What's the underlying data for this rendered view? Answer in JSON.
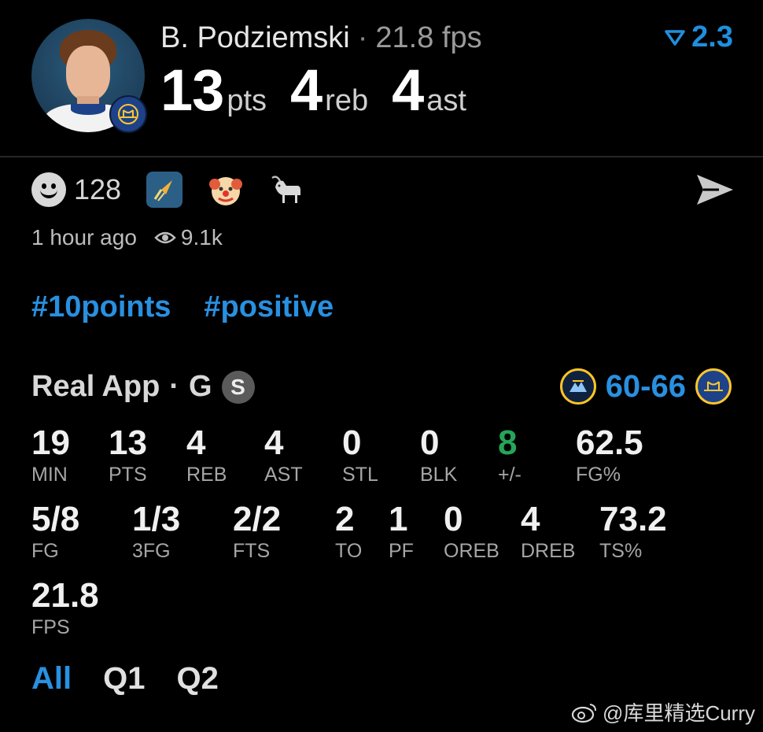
{
  "header": {
    "player_name": "B. Podziemski",
    "separator": "·",
    "fps_label": "21.8 fps",
    "pts_value": "13",
    "pts_unit": "pts",
    "reb_value": "4",
    "reb_unit": "reb",
    "ast_value": "4",
    "ast_unit": "ast",
    "rating": "2.3",
    "rating_icon": "down-chevron-icon",
    "accent_color": "#1f8fe0"
  },
  "reactions": {
    "smile_count": "128",
    "icons": [
      "rocket-icon",
      "clown-icon",
      "goat-icon"
    ],
    "send_icon": "send-icon"
  },
  "meta": {
    "time": "1 hour ago",
    "views": "9.1k"
  },
  "tags": [
    "#10points",
    "#positive"
  ],
  "game": {
    "app": "Real App",
    "dot": "·",
    "position": "G",
    "badge": "S",
    "score": "60-66"
  },
  "stats_row1": [
    {
      "value": "19",
      "label": "MIN"
    },
    {
      "value": "13",
      "label": "PTS"
    },
    {
      "value": "4",
      "label": "REB"
    },
    {
      "value": "4",
      "label": "AST"
    },
    {
      "value": "0",
      "label": "STL"
    },
    {
      "value": "0",
      "label": "BLK"
    },
    {
      "value": "8",
      "label": "+/-",
      "color": "#25a55a"
    },
    {
      "value": "62.5",
      "label": "FG%"
    }
  ],
  "stats_row2": [
    {
      "value": "5/8",
      "label": "FG"
    },
    {
      "value": "1/3",
      "label": "3FG"
    },
    {
      "value": "2/2",
      "label": "FTS"
    },
    {
      "value": "2",
      "label": "TO"
    },
    {
      "value": "1",
      "label": "PF"
    },
    {
      "value": "0",
      "label": "OREB"
    },
    {
      "value": "4",
      "label": "DREB"
    },
    {
      "value": "73.2",
      "label": "TS%"
    }
  ],
  "stats_row3": [
    {
      "value": "21.8",
      "label": "FPS"
    }
  ],
  "tabs": [
    {
      "label": "All",
      "active": true
    },
    {
      "label": "Q1",
      "active": false
    },
    {
      "label": "Q2",
      "active": false
    }
  ],
  "watermark": "@库里精选Curry"
}
